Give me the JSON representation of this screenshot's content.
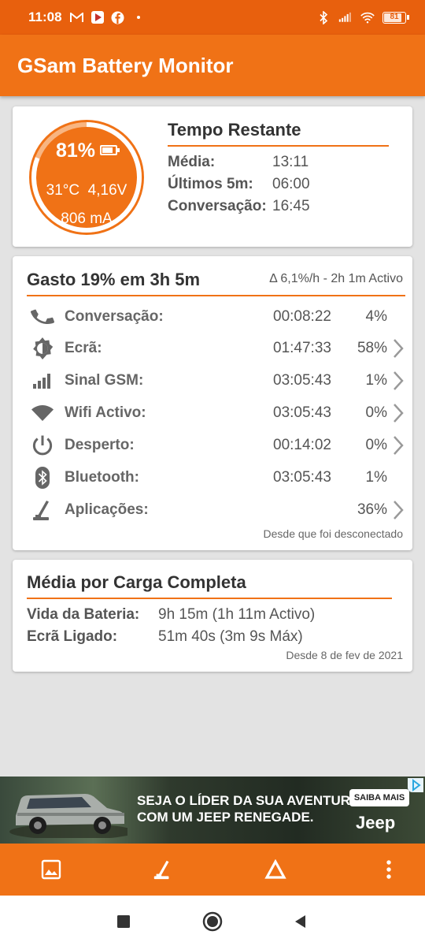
{
  "status_bar": {
    "time": "11:08",
    "battery_level": "81",
    "icons_left": [
      "gmail-icon",
      "youtube-icon",
      "facebook-icon",
      "dot-icon"
    ],
    "icons_right": [
      "bluetooth-icon",
      "signal-icon",
      "wifi-icon",
      "battery-icon"
    ]
  },
  "app_bar": {
    "title": "GSam Battery Monitor"
  },
  "battery_gauge": {
    "percent": "81%",
    "level_fraction": 0.81,
    "temp_voltage": "31°C  4,16V",
    "current": "806 mA"
  },
  "time_remaining": {
    "title": "Tempo Restante",
    "rows": [
      {
        "label": "Média:",
        "value": "13:11"
      },
      {
        "label": "Últimos 5m:",
        "value": "06:00"
      },
      {
        "label": "Conversação:",
        "value": "16:45"
      }
    ]
  },
  "usage": {
    "title": "Gasto 19% em 3h 5m",
    "delta": "Δ 6,1%/h - 2h 1m Activo",
    "rows": [
      {
        "icon": "phone-icon",
        "label": "Conversação:",
        "time": "00:08:22",
        "percent": "4%",
        "has_chevron": false
      },
      {
        "icon": "brightness-icon",
        "label": "Ecrã:",
        "time": "01:47:33",
        "percent": "58%",
        "has_chevron": true
      },
      {
        "icon": "cell-signal-icon",
        "label": "Sinal GSM:",
        "time": "03:05:43",
        "percent": "1%",
        "has_chevron": true
      },
      {
        "icon": "wifi-icon",
        "label": "Wifi Activo:",
        "time": "03:05:43",
        "percent": "0%",
        "has_chevron": true
      },
      {
        "icon": "power-icon",
        "label": "Desperto:",
        "time": "00:14:02",
        "percent": "0%",
        "has_chevron": true
      },
      {
        "icon": "bluetooth-icon",
        "label": "Bluetooth:",
        "time": "03:05:43",
        "percent": "1%",
        "has_chevron": false
      },
      {
        "icon": "apps-icon",
        "label": "Aplicações:",
        "time": "",
        "percent": "36%",
        "has_chevron": true
      }
    ],
    "footer": "Desde que foi desconectado"
  },
  "full_charge_avg": {
    "title": "Média por Carga Completa",
    "rows": [
      {
        "label": "Vida da Bateria:",
        "value": "9h 15m (1h 11m Activo)"
      },
      {
        "label": "Ecrã Ligado:",
        "value": "51m 40s (3m 9s Máx)"
      }
    ],
    "footer": "Desde 8 de fev de 2021"
  },
  "ad": {
    "line1": "SEJA O LÍDER DA SUA AVENTURA",
    "line2": "COM UM JEEP RENEGADE.",
    "cta": "SAIBA MAIS",
    "brand": "Jeep"
  },
  "bottom_bar": {
    "buttons": [
      "image-icon",
      "apps-icon",
      "delta-icon",
      "more-icon"
    ]
  },
  "nav_bar": {
    "buttons": [
      "recents-icon",
      "home-icon",
      "back-icon"
    ]
  },
  "colors": {
    "primary": "#f07216",
    "status": "#e8600d",
    "gauge_light": "#f8b581"
  }
}
